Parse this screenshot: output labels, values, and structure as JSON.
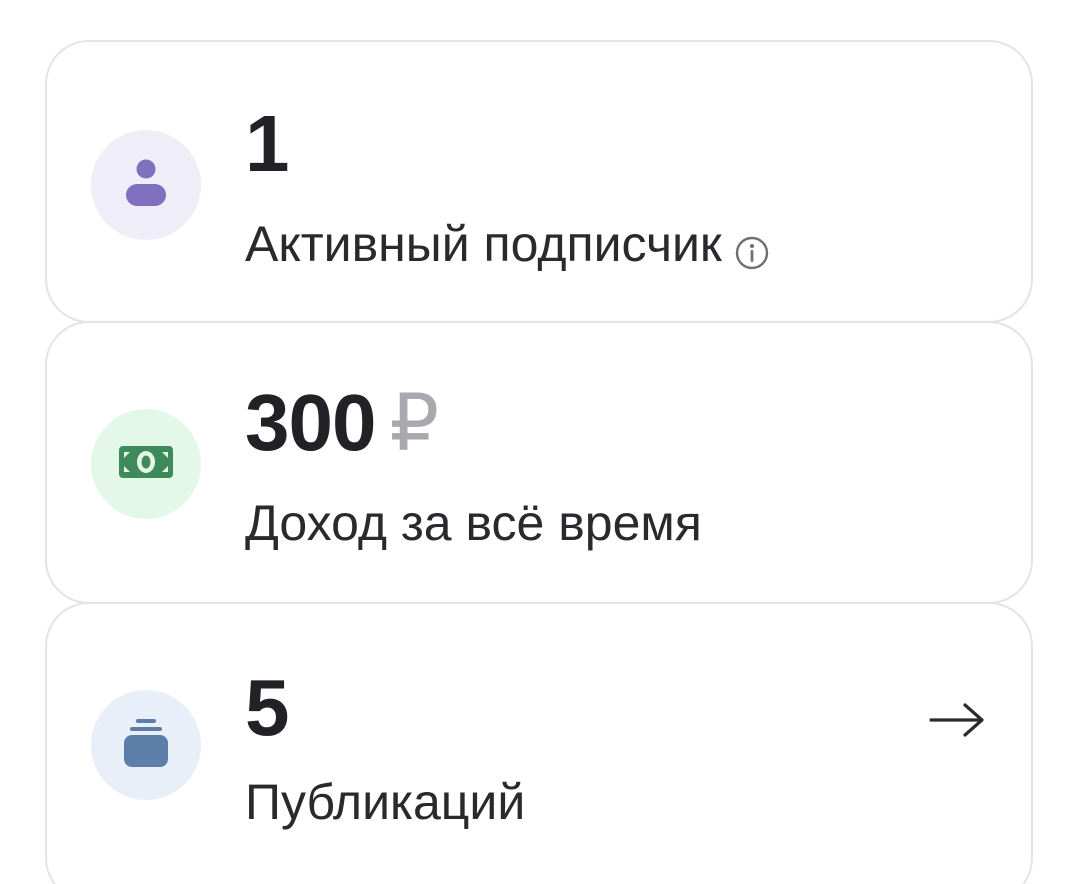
{
  "stats": [
    {
      "value": "1",
      "label": "Активный подписчик",
      "icon": "person-icon",
      "icon_bg": "#efedf8",
      "icon_color": "#7f71bf"
    },
    {
      "value": "300",
      "currency": "₽",
      "label": "Доход за всё время",
      "icon": "money-icon",
      "icon_bg": "#e4f8e9",
      "icon_color": "#3f8a5a"
    },
    {
      "value": "5",
      "label": "Публикаций",
      "icon": "stack-icon",
      "icon_bg": "#e8eff8",
      "icon_color": "#5d7ea8"
    }
  ]
}
